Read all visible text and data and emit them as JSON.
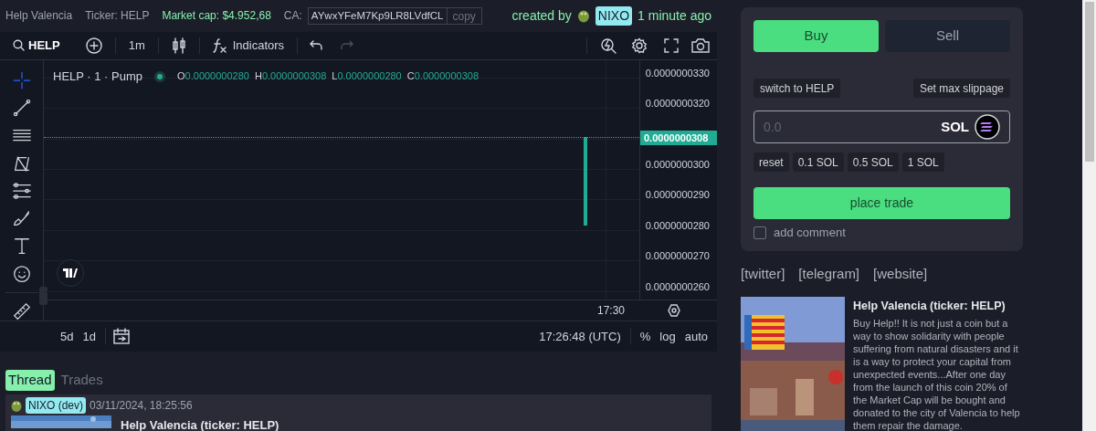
{
  "header": {
    "name": "Help Valencia",
    "ticker": "Ticker: HELP",
    "market_cap": "Market cap: $4.952,68",
    "ca_label": "CA:",
    "ca_value": "AYwxYFeM7Kp9LR8LVdfCL",
    "copy_button": "copy",
    "created_by": "created by",
    "creator": "NIXO",
    "time_ago": "1 minute ago"
  },
  "chart_toolbar": {
    "symbol": "HELP",
    "interval": "1m",
    "indicators": "Indicators"
  },
  "chart": {
    "legend_title": "HELP · 1 · Pump",
    "ohlc": [
      {
        "label": "O",
        "value": "0.0000000280"
      },
      {
        "label": "H",
        "value": "0.0000000308"
      },
      {
        "label": "L",
        "value": "0.0000000280"
      },
      {
        "label": "C",
        "value": "0.0000000308"
      }
    ],
    "price_labels": [
      "0.0000000330",
      "0.0000000320",
      "0.0000000300",
      "0.0000000290",
      "0.0000000280",
      "0.0000000270",
      "0.0000000260"
    ],
    "current_price": "0.0000000308",
    "time_label": "17:30"
  },
  "chart_bottom": {
    "ranges": [
      "5d",
      "1d"
    ],
    "clock": "17:26:48 (UTC)",
    "options": [
      "%",
      "log",
      "auto"
    ]
  },
  "thread_tabs": [
    {
      "label": "Thread",
      "selected": true
    },
    {
      "label": "Trades",
      "selected": false
    }
  ],
  "comment": {
    "user": "NIXO (dev)",
    "date": "03/11/2024, 18:25:56",
    "title": "Help Valencia (ticker: HELP)"
  },
  "trade_panel": {
    "sides": [
      {
        "label": "Buy",
        "selected": true
      },
      {
        "label": "Sell",
        "selected": false
      }
    ],
    "switch_button": "switch to HELP",
    "slippage_button": "Set max slippage",
    "amount": {
      "placeholder": "0.0",
      "currency": "SOL"
    },
    "presets": [
      "reset",
      "0.1 SOL",
      "0.5 SOL",
      "1 SOL"
    ],
    "submit": "place trade",
    "add_comment": {
      "label": "add comment",
      "checked": false
    }
  },
  "links": [
    "[twitter]",
    "[telegram]",
    "[website]"
  ],
  "token_info": {
    "title": "Help Valencia (ticker: HELP)",
    "description": "Buy Help!! It is not just a coin but a way to show solidarity with people suffering from natural disasters and it is a way to protect your capital from unexpected events...After one day from the launch of this coin 20% of the Market Cap will be bought and donated to the city of Valencia to help them repair the damage."
  }
}
